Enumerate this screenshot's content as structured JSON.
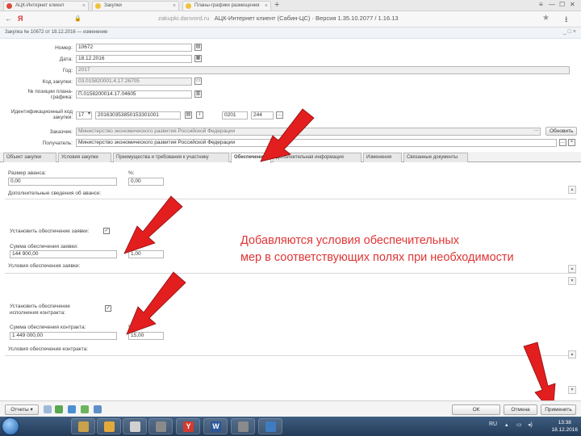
{
  "browser": {
    "tabs": [
      {
        "label": "АЦК-Интернет клиент",
        "color": "#d84a3b"
      },
      {
        "label": "Закупки",
        "color": "#f0c23b"
      },
      {
        "label": "Планы-графики размещения",
        "color": "#f0c23b"
      }
    ],
    "new_tab": "+",
    "window_controls": [
      "≡",
      "—",
      "☐",
      "✕"
    ],
    "back": "←",
    "home_label": "Я",
    "lock": "🔒",
    "address": "zakupki.danvord.ru",
    "page_title": "АЦК-Интернет клиент (Сабин-ЦС) · Версия 1.35.10.2077 / 1.16.13",
    "star": "★",
    "download": "⭳"
  },
  "doc_header": {
    "title": "Закупка № 10672 от 18.12.2016 — изменение",
    "controls": "_ □ ×"
  },
  "form": {
    "number_label": "Номер:",
    "number_value": "10672",
    "date_label": "Дата:",
    "date_value": "18.12.2016",
    "year_label": "Год:",
    "year_value": "2017",
    "purchase_code_label": "Код закупки:",
    "purchase_code_value": "03.015820001.4.17.26705",
    "plan_pos_label": "№ позиции плана-графика:",
    "plan_pos_value": "П.0158200014.17.04605",
    "ikz_label": "Идентификационный код закупки:",
    "ikz_select": "17",
    "ikz_main": "201630353850153301001",
    "ikz_part2": "0201",
    "ikz_part3": "244",
    "customer_label": "Заказчик:",
    "customer_value": "Министерство экономического развития Российской Федерации",
    "customer_button": "Обновить",
    "recipient_label": "Получатель:",
    "recipient_value": "Министерство экономического развития Российской Федерации"
  },
  "tabs": [
    {
      "label": "Объект закупки"
    },
    {
      "label": "Условия закупки"
    },
    {
      "label": "Преимущества и требования к участнику"
    },
    {
      "label": "Обеспечение"
    },
    {
      "label": "Дополнительная информация"
    },
    {
      "label": "Изменения"
    },
    {
      "label": "Связанные документы"
    }
  ],
  "obesp": {
    "advance_label": "Размер аванса:",
    "advance_value": "0,00",
    "advance_pct_label": "%:",
    "advance_pct_value": "0,00",
    "advance_cond_label": "Дополнительные сведения об авансе:",
    "bid_check_label": "Установить обеспечение заявки:",
    "bid_checked": "✓",
    "bid_sum_label": "Сумма обеспечения заявки:",
    "bid_sum_value": "144 900,00",
    "bid_pct_label": "%:",
    "bid_pct_value": "1,00",
    "bid_terms_label": "Условия обеспечения заявки:",
    "contract_check_label": "Установить обеспечение исполнения контракта:",
    "contract_checked": "✓",
    "contract_sum_label": "Сумма обеспечения контракта:",
    "contract_sum_value": "1 449 000,00",
    "contract_pct_label": "%:",
    "contract_pct_value": "15,00",
    "contract_terms_label": "Условия обеспечения контракта:"
  },
  "annotation": {
    "line1": "Добавляются условия обеспечительных",
    "line2": "мер в соответствующих полях при необходимости",
    "color": "#e03535"
  },
  "bottom": {
    "reports_button": "Отчеты ▾",
    "ok_button": "ОК",
    "cancel_button": "Отмена",
    "apply_button": "Применить"
  },
  "taskbar": {
    "apps": [
      {
        "glyph": "",
        "color": "#c8a24a"
      },
      {
        "glyph": "",
        "color": "#e2a93b"
      },
      {
        "glyph": "",
        "color": "#d0d0d0"
      },
      {
        "glyph": "Y",
        "color": "#d23a2f"
      },
      {
        "glyph": "W",
        "color": "#2b579a"
      },
      {
        "glyph": "",
        "color": "#8a8a8a"
      },
      {
        "glyph": "",
        "color": "#3e7cc2"
      }
    ],
    "lang": "RU",
    "time": "13:38",
    "date": "18.12.2016"
  }
}
